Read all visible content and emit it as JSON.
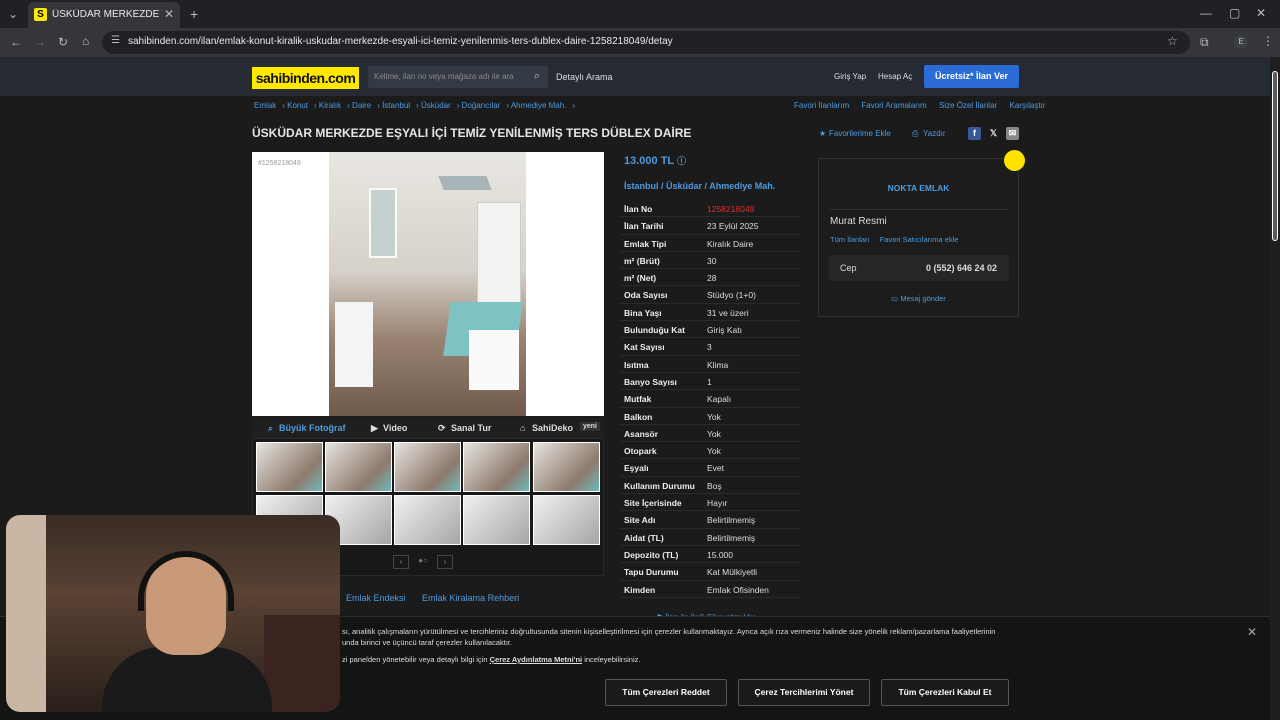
{
  "browser": {
    "tab_title": "ÜSKÜDAR MERKEZDE EŞYALI İÇ",
    "tab_favicon": "S",
    "url": "sahibinden.com/ilan/emlak-konut-kiralik-uskudar-merkezde-esyali-ici-temiz-yenilenmis-ters-dublex-daire-1258218049/detay",
    "profile_initial": "E"
  },
  "header": {
    "logo": "sahibinden.com",
    "search_placeholder": "Kelime, ilan no veya mağaza adı ile ara",
    "detailed_search": "Detaylı Arama",
    "login": "Giriş Yap",
    "register": "Hesap Aç",
    "post_ad": "Ücretsiz* İlan Ver"
  },
  "breadcrumbs": [
    "Emlak",
    "Konut",
    "Kiralık",
    "Daire",
    "İstanbul",
    "Üsküdar",
    "Doğancılar",
    "Ahmediye Mah."
  ],
  "right_links": [
    "Favori İlanlarım",
    "Favori Aramalarım",
    "Size Özel İlanlar",
    "Karşılaştır"
  ],
  "listing": {
    "title": "ÜSKÜDAR MERKEZDE EŞYALI İÇİ TEMİZ YENİLENMİŞ TERS DÜBLEX DAİRE",
    "add_favorite": "Favorilerime Ekle",
    "print": "Yazdır",
    "photo_id": "#1258218049",
    "media": {
      "big_photo": "Büyük Fotoğraf",
      "video": "Video",
      "virtual_tour": "Sanal Tur",
      "sahideko": "SahiDeko",
      "new_badge": "yeni"
    },
    "price": "13.000 TL",
    "location": [
      "İstanbul",
      "Üsküdar",
      "Ahmediye Mah."
    ],
    "details": [
      {
        "k": "İlan No",
        "v": "1258218049"
      },
      {
        "k": "İlan Tarihi",
        "v": "23 Eylül 2025"
      },
      {
        "k": "Emlak Tipi",
        "v": "Kiralık Daire"
      },
      {
        "k": "m² (Brüt)",
        "v": "30"
      },
      {
        "k": "m² (Net)",
        "v": "28"
      },
      {
        "k": "Oda Sayısı",
        "v": "Stüdyo (1+0)"
      },
      {
        "k": "Bina Yaşı",
        "v": "31 ve üzeri"
      },
      {
        "k": "Bulunduğu Kat",
        "v": "Giriş Katı"
      },
      {
        "k": "Kat Sayısı",
        "v": "3"
      },
      {
        "k": "Isıtma",
        "v": "Klima"
      },
      {
        "k": "Banyo Sayısı",
        "v": "1"
      },
      {
        "k": "Mutfak",
        "v": "Kapalı"
      },
      {
        "k": "Balkon",
        "v": "Yok"
      },
      {
        "k": "Asansör",
        "v": "Yok"
      },
      {
        "k": "Otopark",
        "v": "Yok"
      },
      {
        "k": "Eşyalı",
        "v": "Evet"
      },
      {
        "k": "Kullanım Durumu",
        "v": "Boş"
      },
      {
        "k": "Site İçerisinde",
        "v": "Hayır"
      },
      {
        "k": "Site Adı",
        "v": "Belirtilmemiş"
      },
      {
        "k": "Aidat (TL)",
        "v": "Belirtilmemiş"
      },
      {
        "k": "Depozito (TL)",
        "v": "15.000"
      },
      {
        "k": "Tapu Durumu",
        "v": "Kat Mülkiyetli"
      },
      {
        "k": "Kimden",
        "v": "Emlak Ofisinden"
      }
    ],
    "subnav": [
      "Emlak Endeksi",
      "Emlak Kiralama Rehberi"
    ],
    "fraud_note": "İlan ile İlgili Şikayetim Var"
  },
  "seller": {
    "firm": "NOKTA EMLAK",
    "name": "Murat Resmi",
    "all_listings": "Tüm İlanları",
    "fav_seller": "Favori Satıcılarıma ekle",
    "phone_label": "Cep",
    "phone": "0 (552) 646 24 02",
    "send_message": "Mesaj gönder"
  },
  "cookie": {
    "text1": "sı, analitik çalışmaların yürütülmesi ve tercihleriniz doğrultusunda sitenin kişiselleştirilmesi için çerezler kullanmaktayız. Ayrıca açık rıza vermeniz halinde size yönelik reklam/pazarlama faaliyetlerinin",
    "text1b": "unda birinci ve üçüncü taraf çerezler kullanılacaktır.",
    "text2_pre": "zi panelden yönetebilir veya detaylı bilgi için",
    "text2_link": "Çerez Aydınlatma Metni'ni",
    "text2_post": "inceleyebilirsiniz.",
    "reject": "Tüm Çerezleri Reddet",
    "manage": "Çerez Tercihlerimi Yönet",
    "accept": "Tüm Çerezleri Kabul Et"
  }
}
